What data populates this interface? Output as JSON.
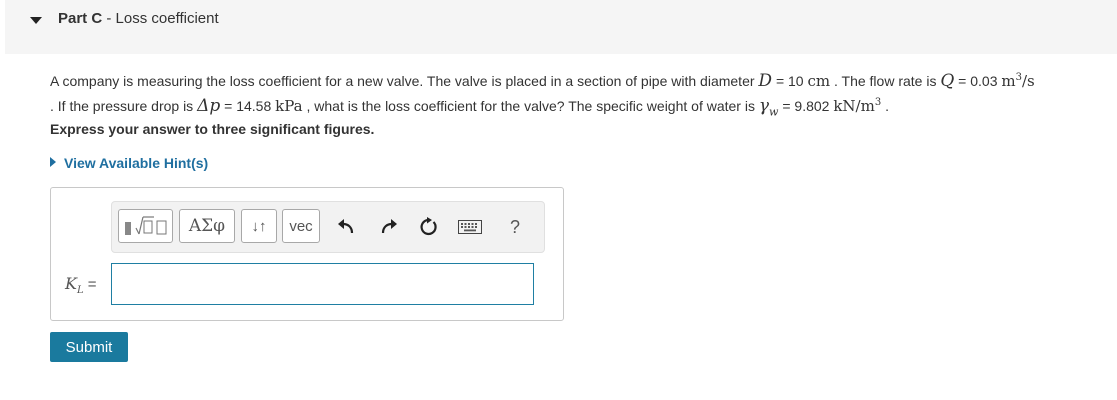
{
  "part": {
    "label": "Part C",
    "separator": " - ",
    "title": "Loss coefficient"
  },
  "question": {
    "t1": "A company is measuring the loss coefficient for a new valve. The valve is placed in a section of pipe with diameter ",
    "D_symbol": "D",
    "eq1": " = 10 ",
    "D_unit": "cm",
    "t2": " . The flow rate is ",
    "Q_symbol": "Q",
    "eq2": " = 0.03 ",
    "Q_unit_base": "m",
    "Q_unit_exp": "3",
    "Q_unit_tail": "/s",
    "t3": ". If the pressure drop is ",
    "dp_symbol": "Δp",
    "eq3": " = 14.58 ",
    "dp_unit": "kPa",
    "t4": " , what is the loss coefficient for the valve? The specific weight of water is ",
    "gamma_symbol": "γ",
    "gamma_sub": "w",
    "eq4": " = 9.802 ",
    "gamma_unit_base": "kN/m",
    "gamma_unit_exp": "3",
    "t5": " ."
  },
  "instruction": "Express your answer to three significant figures.",
  "hint_link": "View Available Hint(s)",
  "toolbar": {
    "greek_label": "ΑΣφ",
    "arrows_label": "↓↑",
    "vec_label": "vec",
    "help_label": "?"
  },
  "answer": {
    "variable": "K",
    "variable_sub": "L",
    "equals": " =",
    "value": ""
  },
  "submit_label": "Submit",
  "colors": {
    "accent": "#1a7a9e",
    "link": "#1f6fa0",
    "header_bg": "#f5f5f5"
  },
  "icons": [
    "caret-down-icon",
    "templates-icon",
    "undo-icon",
    "redo-icon",
    "reset-icon",
    "keyboard-icon",
    "help-icon"
  ]
}
